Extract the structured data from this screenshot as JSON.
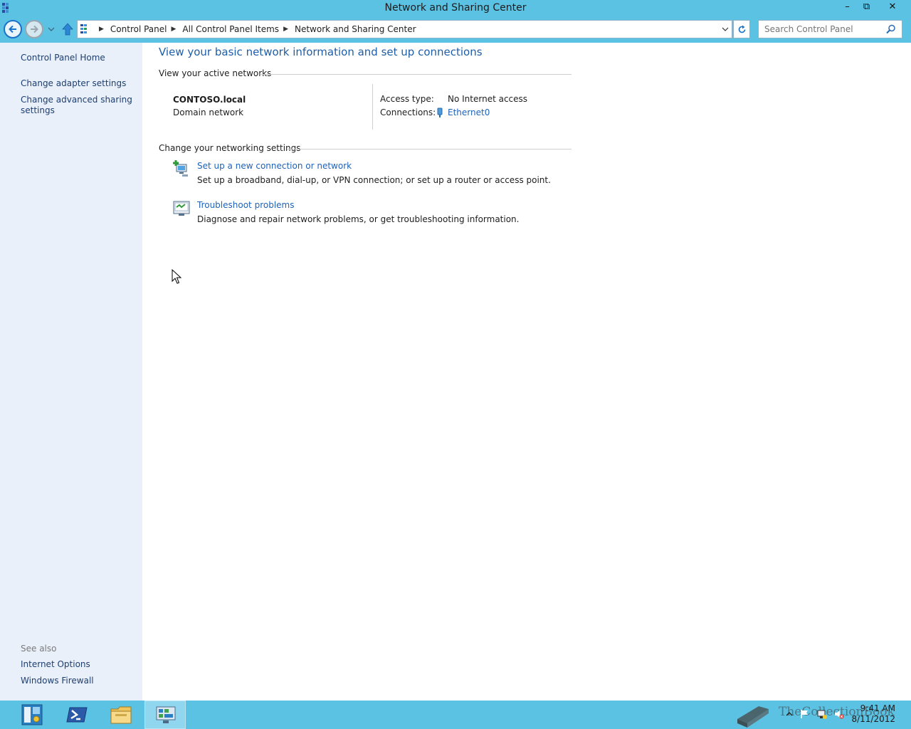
{
  "window": {
    "title": "Network and Sharing Center",
    "minimize_glyph": "–",
    "maximize_glyph": "⧉",
    "close_glyph": "✕"
  },
  "address_bar": {
    "crumbs": [
      "Control Panel",
      "All Control Panel Items",
      "Network and Sharing Center"
    ],
    "search_placeholder": "Search Control Panel"
  },
  "sidebar": {
    "items": [
      {
        "label": "Control Panel Home"
      },
      {
        "label": "Change adapter settings"
      },
      {
        "label": "Change advanced sharing settings"
      }
    ],
    "see_also_label": "See also",
    "see_also_items": [
      {
        "label": "Internet Options"
      },
      {
        "label": "Windows Firewall"
      }
    ]
  },
  "main": {
    "heading": "View your basic network information and set up connections",
    "active_networks_label": "View your active networks",
    "network": {
      "name": "CONTOSO.local",
      "type": "Domain network",
      "access_type_label": "Access type:",
      "access_type_value": "No Internet access",
      "connections_label": "Connections:",
      "connection_name": "Ethernet0"
    },
    "change_settings_label": "Change your networking settings",
    "tasks": [
      {
        "link": "Set up a new connection or network",
        "description": "Set up a broadband, dial-up, or VPN connection; or set up a router or access point.",
        "icon": "new-connection-icon"
      },
      {
        "link": "Troubleshoot problems",
        "description": "Diagnose and repair network problems, or get troubleshooting information.",
        "icon": "troubleshoot-icon"
      }
    ]
  },
  "taskbar": {
    "clock_time": "9:41 AM",
    "clock_date": "8/11/2012",
    "watermark_text": "TheCollectionBook",
    "pinned": [
      {
        "icon": "server-manager-icon"
      },
      {
        "icon": "powershell-icon"
      },
      {
        "icon": "file-explorer-icon"
      },
      {
        "icon": "control-panel-icon",
        "active": true
      }
    ]
  },
  "colors": {
    "chrome": "#5cc2e4",
    "sidebar_bg": "#e9f0fa",
    "link": "#1e62b8",
    "heading": "#1e5ea8"
  }
}
